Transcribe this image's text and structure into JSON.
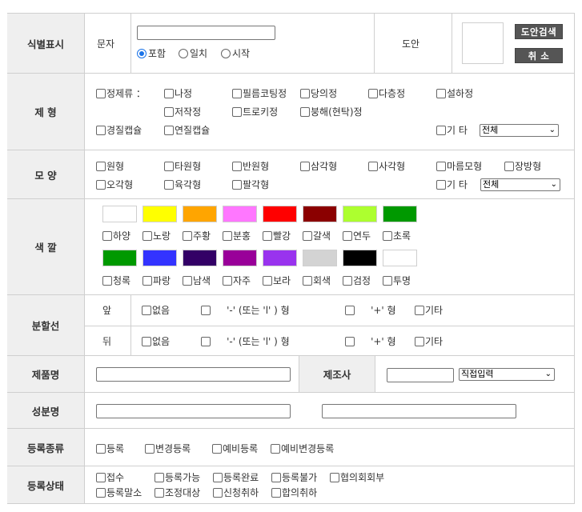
{
  "id_marking": {
    "header": "식별표시",
    "text_label": "문자",
    "text_value": "",
    "match_options": [
      {
        "label": "포함",
        "checked": true
      },
      {
        "label": "일치",
        "checked": false
      },
      {
        "label": "시작",
        "checked": false
      }
    ],
    "design_label": "도안",
    "search_button": "도안검색",
    "cancel_button": "취 소"
  },
  "form": {
    "header": "제 형",
    "items": [
      "정제류 ：",
      "나정",
      "필름코팅정",
      "당의정",
      "다층정",
      "설하정",
      "저작정",
      "트로키정",
      "붕해(현탁)정",
      "경질캡슐",
      "연질캡슐",
      "기 타"
    ],
    "other_select": "전체"
  },
  "shape": {
    "header": "모 양",
    "items": [
      "원형",
      "타원형",
      "반원형",
      "삼각형",
      "사각형",
      "마름모형",
      "장방형",
      "오각형",
      "육각형",
      "팔각형",
      "기 타"
    ],
    "other_select": "전체"
  },
  "color": {
    "header": "색 깔",
    "row1": [
      {
        "label": "하양",
        "hex": "#ffffff"
      },
      {
        "label": "노랑",
        "hex": "#ffff00"
      },
      {
        "label": "주황",
        "hex": "#ffa500"
      },
      {
        "label": "분홍",
        "hex": "#ff77ff"
      },
      {
        "label": "빨강",
        "hex": "#ff0000"
      },
      {
        "label": "갈색",
        "hex": "#8b0000"
      },
      {
        "label": "연두",
        "hex": "#adff2f"
      },
      {
        "label": "초록",
        "hex": "#009900"
      }
    ],
    "row2": [
      {
        "label": "청록",
        "hex": "#009900"
      },
      {
        "label": "파랑",
        "hex": "#3333ff"
      },
      {
        "label": "남색",
        "hex": "#330066"
      },
      {
        "label": "자주",
        "hex": "#990099"
      },
      {
        "label": "보라",
        "hex": "#9933ee"
      },
      {
        "label": "회색",
        "hex": "#d3d3d3"
      },
      {
        "label": "검정",
        "hex": "#000000"
      },
      {
        "label": "투명",
        "hex": "#ffffff"
      }
    ]
  },
  "score_line": {
    "header": "분할선",
    "front_label": "앞",
    "back_label": "뒤",
    "none": "없음",
    "dash_text": "'-' (또는 'l' ) 형",
    "plus_text": "'+' 형",
    "other": "기타"
  },
  "product": {
    "header": "제품명",
    "value": "",
    "maker_header": "제조사",
    "maker_value": "",
    "maker_select": "직접입력"
  },
  "ingredient": {
    "header": "성분명",
    "value1": "",
    "value2": ""
  },
  "reg_type": {
    "header": "등록종류",
    "items": [
      "등록",
      "변경등록",
      "예비등록",
      "예비변경등록"
    ]
  },
  "reg_status": {
    "header": "등록상태",
    "row1": [
      "접수",
      "등록가능",
      "등록완료",
      "등록불가",
      "협의회회부"
    ],
    "row2": [
      "등록말소",
      "조정대상",
      "신청취하",
      "합의취하"
    ]
  }
}
